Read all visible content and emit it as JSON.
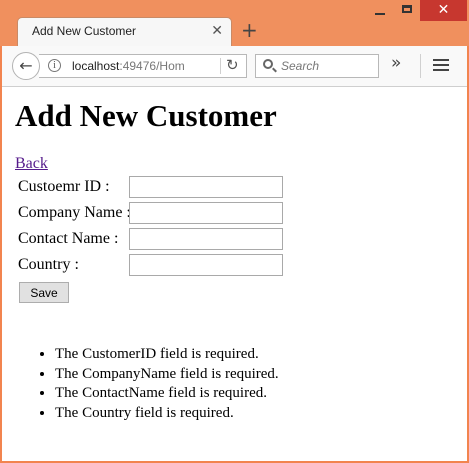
{
  "browser": {
    "tab_title": "Add New Customer",
    "tab_close_glyph": "✕",
    "new_tab_glyph": "+",
    "window_close_glyph": "✕",
    "back_glyph": "←",
    "url_host": "localhost",
    "url_rest": ":49476/Hom",
    "reload_glyph": "↻",
    "search_placeholder": "Search",
    "overflow_glyph": "»",
    "icons": [
      "back-arrow-icon",
      "info-icon",
      "reload-icon",
      "search-icon",
      "overflow-icon",
      "hamburger-menu-icon",
      "minimize-icon",
      "maximize-icon",
      "close-icon"
    ]
  },
  "page": {
    "title": "Add New Customer",
    "back_link": "Back",
    "form": {
      "fields": [
        {
          "label": "Custoemr ID :",
          "value": ""
        },
        {
          "label": "Company Name :",
          "value": ""
        },
        {
          "label": "Contact Name :",
          "value": ""
        },
        {
          "label": "Country :",
          "value": ""
        }
      ],
      "save_label": "Save"
    },
    "errors": [
      "The CustomerID field is required.",
      "The CompanyName field is required.",
      "The ContactName field is required.",
      "The Country field is required."
    ]
  },
  "colors": {
    "window_frame": "#f2844f",
    "close_button": "#c7372f",
    "visited_link": "#551a8b"
  }
}
